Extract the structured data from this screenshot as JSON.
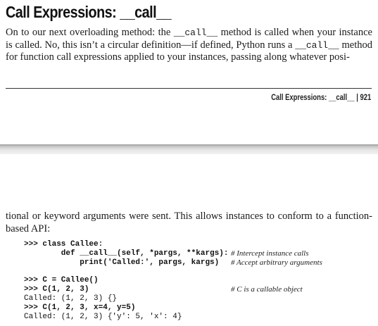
{
  "top_page": {
    "heading": "Call Expressions: __call__",
    "para": {
      "t1": "On to our next overloading method: the ",
      "c1": "__call__",
      "t2": " method is called when your instance is called. No, this isn’t a circular definition—if defined, Python runs a ",
      "c2": "__call__",
      "t3": " method for function call expressions applied to your instances, passing along whatever posi-"
    },
    "footer": "Call Expressions: __call__   |   921"
  },
  "bottom_page": {
    "para": "tional or keyword arguments were sent. This allows instances to conform to a function-based API:",
    "code": [
      {
        "text": ">>> class Callee:",
        "bold": true,
        "comment": ""
      },
      {
        "text": "        def __call__(self, *pargs, **kargs):",
        "bold": true,
        "comment": "# Intercept instance calls"
      },
      {
        "text": "            print('Called:', pargs, kargs)",
        "bold": true,
        "comment": "# Accept arbitrary arguments"
      },
      {
        "text": "",
        "bold": false,
        "comment": ""
      },
      {
        "text": ">>> C = Callee()",
        "bold": true,
        "comment": ""
      },
      {
        "text": ">>> C(1, 2, 3)",
        "bold": true,
        "comment": "# C is a callable object"
      },
      {
        "text": "Called: (1, 2, 3) {}",
        "bold": false,
        "comment": ""
      },
      {
        "text": ">>> C(1, 2, 3, x=4, y=5)",
        "bold": true,
        "comment": ""
      },
      {
        "text": "Called: (1, 2, 3) {'y': 5, 'x': 4}",
        "bold": false,
        "comment": ""
      }
    ]
  }
}
